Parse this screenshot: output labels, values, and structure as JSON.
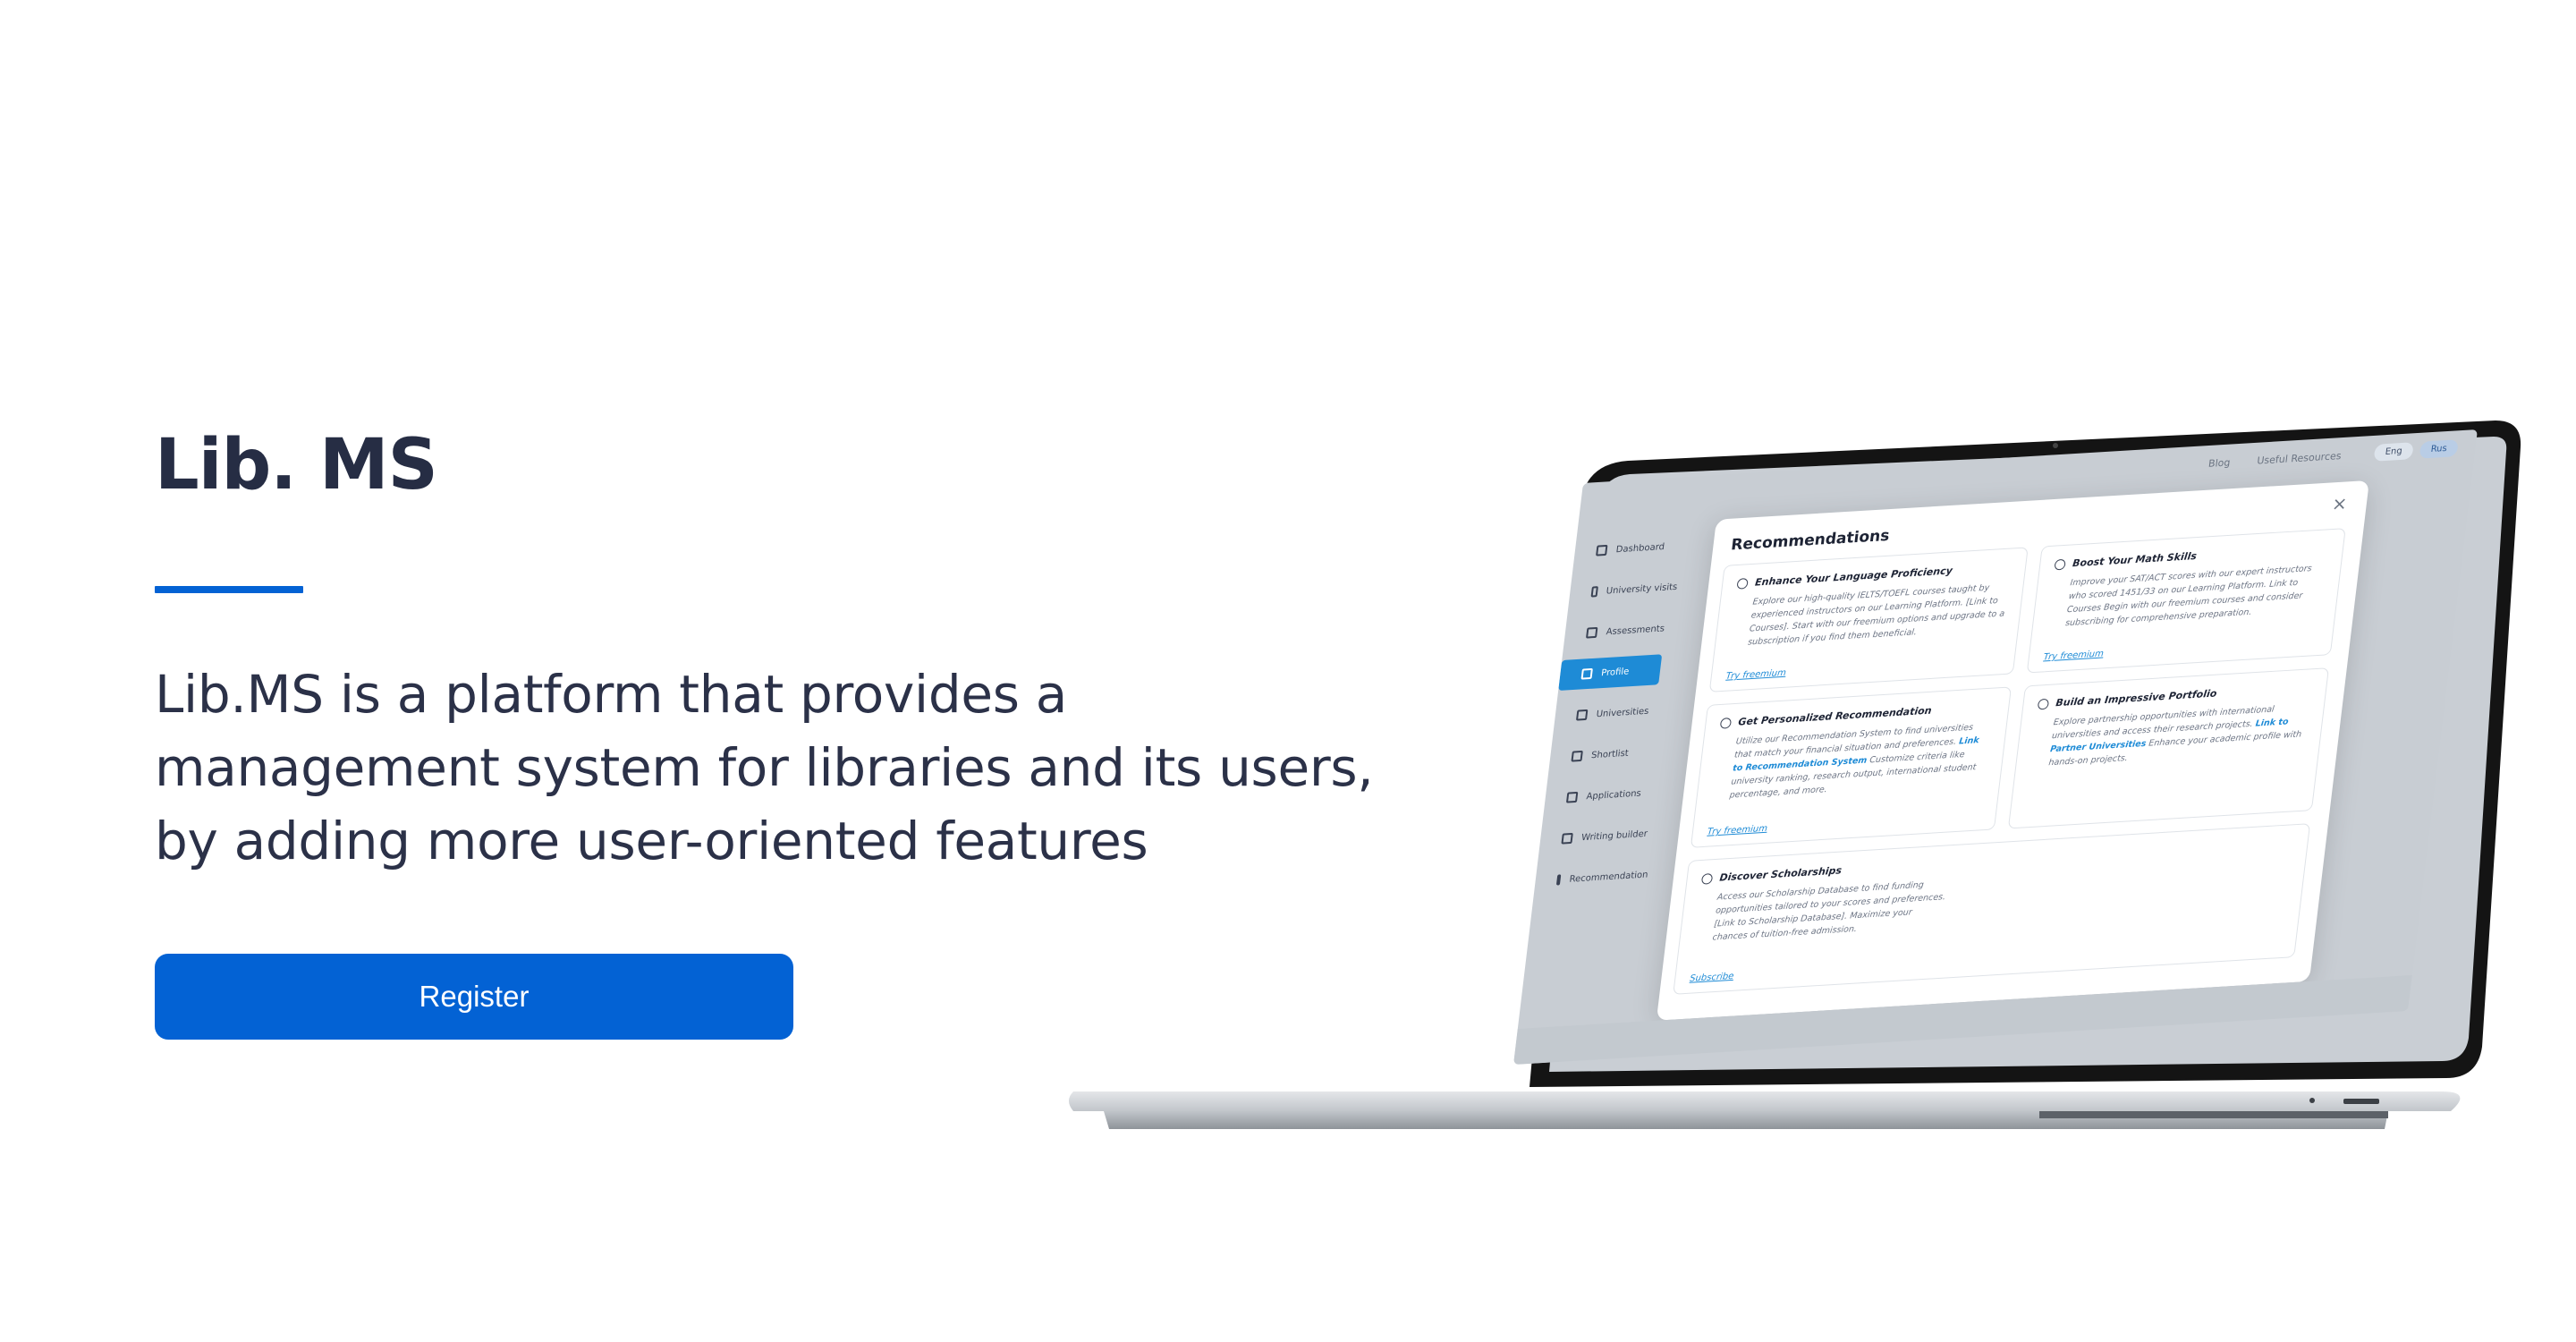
{
  "hero": {
    "title": "Lib. MS",
    "description": "Lib.MS is a platform that provides a management system for libraries and its users, by adding more user-oriented features",
    "register_label": "Register"
  },
  "colors": {
    "brand_blue": "#0362d4",
    "heading": "#262d44",
    "app_accent": "#1e8bd6"
  },
  "mockup": {
    "header": {
      "nav": [
        "Blog",
        "Useful Resources"
      ],
      "lang_primary": "Eng",
      "lang_secondary": "Rus"
    },
    "sidebar": [
      {
        "label": "Dashboard",
        "icon": "dashboard-icon",
        "active": false
      },
      {
        "label": "University visits",
        "icon": "calendar-icon",
        "active": false
      },
      {
        "label": "Assessments",
        "icon": "document-icon",
        "active": false
      },
      {
        "label": "Profile",
        "icon": "user-icon",
        "active": true
      },
      {
        "label": "Universities",
        "icon": "bank-icon",
        "active": false
      },
      {
        "label": "Shortlist",
        "icon": "bookmark-icon",
        "active": false
      },
      {
        "label": "Applications",
        "icon": "home-icon",
        "active": false
      },
      {
        "label": "Writing builder",
        "icon": "pencil-icon",
        "active": false
      },
      {
        "label": "Recommendation",
        "icon": "mail-icon",
        "active": false
      }
    ],
    "modal": {
      "title": "Recommendations",
      "cards": [
        {
          "title": "Enhance Your Language Proficiency",
          "body": "Explore our high-quality IELTS/TOEFL courses taught by experienced instructors on our Learning Platform. [Link to Courses]. Start with our freemium options and upgrade to a subscription if you find them beneficial.",
          "cta": "Try freemium"
        },
        {
          "title": "Boost Your Math Skills",
          "body": "Improve your SAT/ACT scores with our expert instructors who scored 1451/33 on our Learning Platform. Link to Courses Begin with our freemium courses and consider subscribing for comprehensive preparation.",
          "cta": "Try freemium"
        },
        {
          "title": "Get Personalized Recommendation",
          "body": "Utilize our Recommendation System to find universities that match your financial situation and preferences.",
          "link": "Link to Recommendation System",
          "body2": "Customize criteria like university ranking, research output, international student percentage, and more.",
          "cta": "Try freemium"
        },
        {
          "title": "Build an Impressive Portfolio",
          "body": "Explore partnership opportunities with international universities and access their research projects.",
          "link": "Link to Partner Universities",
          "body2": "Enhance your academic profile with hands-on projects.",
          "cta": ""
        },
        {
          "title": "Discover Scholarships",
          "body": "Access our Scholarship Database to find funding opportunities tailored to your scores and preferences. [Link to Scholarship Database]. Maximize your chances of tuition-free admission.",
          "cta": "Subscribe"
        }
      ]
    }
  }
}
